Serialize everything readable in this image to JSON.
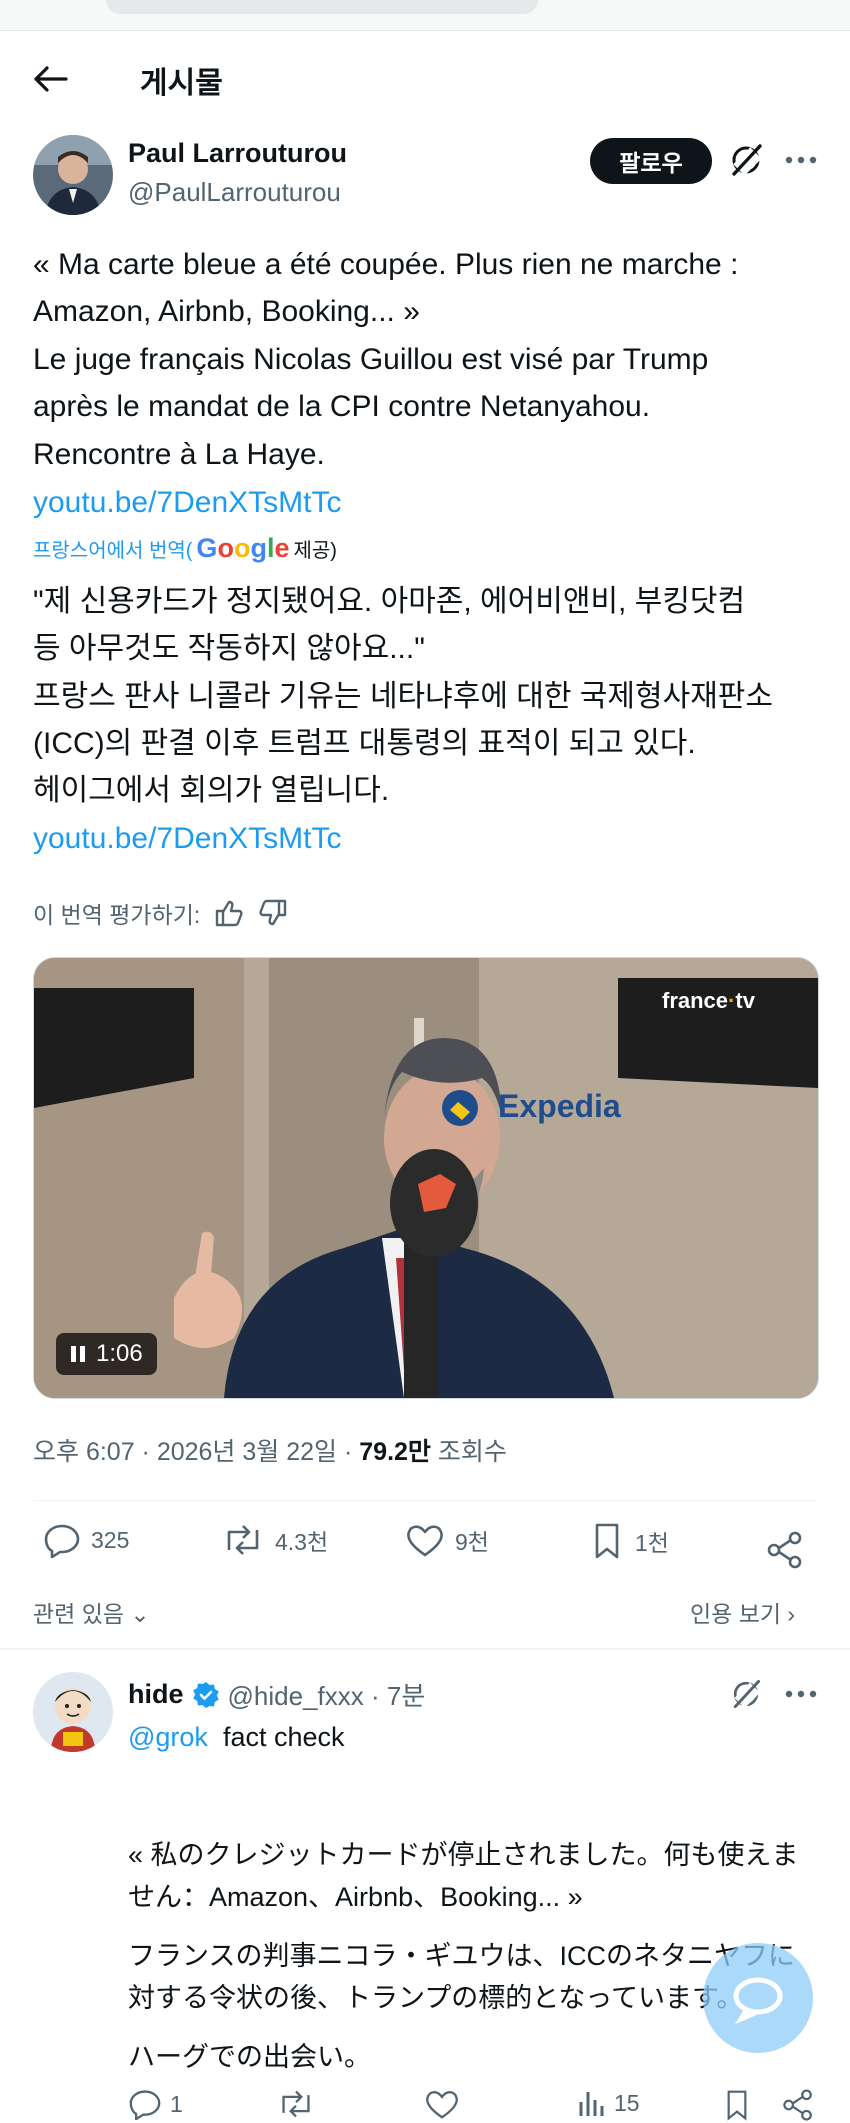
{
  "header": {
    "title": "게시물"
  },
  "post": {
    "author_name": "Paul Larrouturou",
    "author_handle": "@PaulLarrouturou",
    "follow_label": "팔로우",
    "text_lines": [
      "« Ma carte bleue a été coupée. Plus rien ne marche :",
      "Amazon, Airbnb, Booking... »",
      "Le juge français Nicolas Guillou est visé par Trump",
      "après le mandat de la CPI contre Netanyahou.",
      "Rencontre à La Haye."
    ],
    "link": "youtu.be/7DenXTsMtTc",
    "translation_label": "프랑스어에서 번역(",
    "translation_provider": "Google",
    "translation_suffix": "제공)",
    "translated_lines": [
      "\"제 신용카드가 정지됐어요. 아마존, 에어비앤비, 부킹닷컴",
      "등 아무것도 작동하지 않아요...\"",
      "프랑스 판사 니콜라 기유는 네타냐후에 대한 국제형사재판소",
      "(ICC)의 판결 이후 트럼프 대통령의 표적이 되고 있다.",
      "헤이그에서 회의가 열립니다."
    ],
    "translated_link": "youtu.be/7DenXTsMtTc",
    "rate_label": "이 번역 평가하기:",
    "video": {
      "duration": "1:06",
      "logo_france": "france",
      "logo_tv": "tv",
      "sponsor": "Expedia"
    },
    "meta_time": "오후 6:07 · 2026년 3월 22일 · ",
    "meta_views": "79.2만",
    "meta_views_label": " 조회수",
    "stats": {
      "replies": "325",
      "reposts": "4.3천",
      "likes": "9천",
      "bookmarks": "1천"
    },
    "related_label": "관련 있음",
    "quotes_label": "인용 보기"
  },
  "reply": {
    "name": "hide",
    "handle": "@hide_fxxx · 7분",
    "mention": "@grok",
    "text": "fact check",
    "lines": [
      "« 私のクレジットカードが停止されました。何も使えま",
      "せん：Amazon、Airbnb、Booking... »",
      "フランスの判事ニコラ・ギユウは、ICCのネタニヤフに",
      "対する令状の後、トランプの標的となっています。",
      "ハーグでの出会い。"
    ],
    "stats": {
      "replies": "1",
      "views": "15"
    }
  }
}
